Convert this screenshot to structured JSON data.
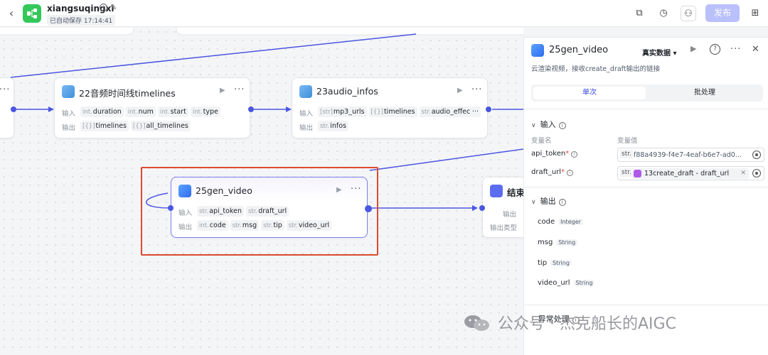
{
  "header": {
    "app_name": "xiangsuqingxi",
    "autosave": "已自动保存 17:14:41",
    "publish_label": "发布"
  },
  "nodes": {
    "timelines": {
      "title": "22音频时间线timelines",
      "input_label": "输入",
      "output_label": "输出",
      "inputs": [
        {
          "type": "int.",
          "name": "duration"
        },
        {
          "type": "int.",
          "name": "num"
        },
        {
          "type": "int.",
          "name": "start"
        },
        {
          "type": "int.",
          "name": "type"
        }
      ],
      "outputs": [
        {
          "type": "[{}]",
          "name": "timelines"
        },
        {
          "type": "[{}]",
          "name": "all_timelines"
        }
      ]
    },
    "audio_infos": {
      "title": "23audio_infos",
      "input_label": "输入",
      "output_label": "输出",
      "inputs": [
        {
          "type": "[str]",
          "name": "mp3_urls"
        },
        {
          "type": "[{}]",
          "name": "timelines"
        },
        {
          "type": "str.",
          "name": "audio_effect"
        }
      ],
      "outputs": [
        {
          "type": "str.",
          "name": "infos"
        }
      ]
    },
    "gen_video": {
      "title": "25gen_video",
      "input_label": "输入",
      "output_label": "输出",
      "inputs": [
        {
          "type": "str.",
          "name": "api_token"
        },
        {
          "type": "str.",
          "name": "draft_url"
        }
      ],
      "outputs": [
        {
          "type": "int.",
          "name": "code"
        },
        {
          "type": "str.",
          "name": "msg"
        },
        {
          "type": "str.",
          "name": "tip"
        },
        {
          "type": "str.",
          "name": "video_url"
        }
      ]
    },
    "end": {
      "title": "结束",
      "output_label": "输出",
      "output_type_label": "输出类型"
    }
  },
  "panel": {
    "title": "25gen_video",
    "mode": "真实数据",
    "description": "云渲染视频，接收create_draft输出的链接",
    "tab_single": "单次",
    "tab_batch": "批处理",
    "input_section": "输入",
    "col_name": "变量名",
    "col_value": "变量值",
    "params": [
      {
        "name": "api_token",
        "type": "str.",
        "value": "f88a4939-f4e7-4eaf-b6e7-ad0..."
      },
      {
        "name": "draft_url",
        "type": "str.",
        "ref": "13create_draft - draft_url"
      }
    ],
    "output_section": "输出",
    "outputs": [
      {
        "name": "code",
        "type": "Integer"
      },
      {
        "name": "msg",
        "type": "String"
      },
      {
        "name": "tip",
        "type": "String"
      },
      {
        "name": "video_url",
        "type": "String"
      }
    ],
    "exception_section": "异常处理"
  },
  "watermark": "公众号 · 杰克船长的AIGC",
  "colors": {
    "accent": "#4b56e0",
    "highlight": "#e0492f",
    "publish": "#b9c0fb"
  }
}
